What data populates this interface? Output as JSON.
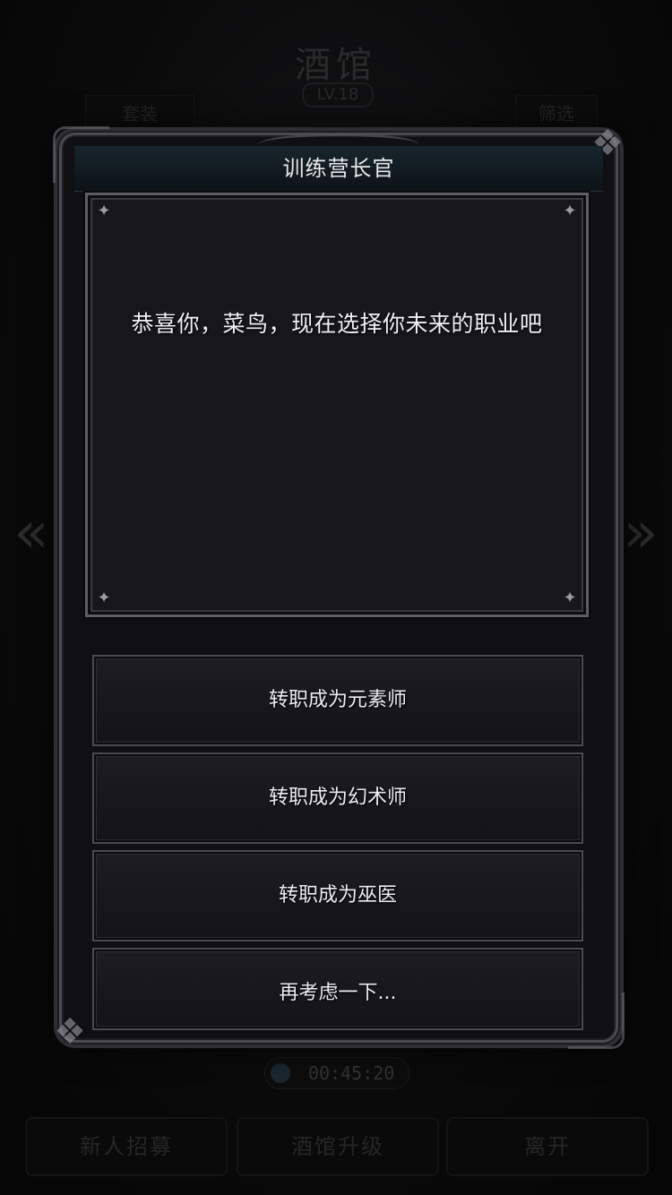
{
  "background": {
    "title": "酒馆",
    "level": "LV.18",
    "tab_left": "套装",
    "tab_right": "筛选",
    "timer": "00:45:20",
    "bottom_buttons": [
      "新人招募",
      "酒馆升级",
      "离开"
    ]
  },
  "nav": {
    "prev_glyph": "«",
    "next_glyph": "»"
  },
  "dialog": {
    "title": "训练营长官",
    "message": "恭喜你，菜鸟，现在选择你未来的职业吧",
    "options": [
      {
        "label": "转职成为元素师"
      },
      {
        "label": "转职成为幻术师"
      },
      {
        "label": "转职成为巫医"
      },
      {
        "label": "再考虑一下..."
      }
    ]
  },
  "colors": {
    "background": "#0b0b0c",
    "panel": "#17171a",
    "frame": "#5c5c63",
    "header": "#18242c",
    "text": "#f0f0f2"
  }
}
